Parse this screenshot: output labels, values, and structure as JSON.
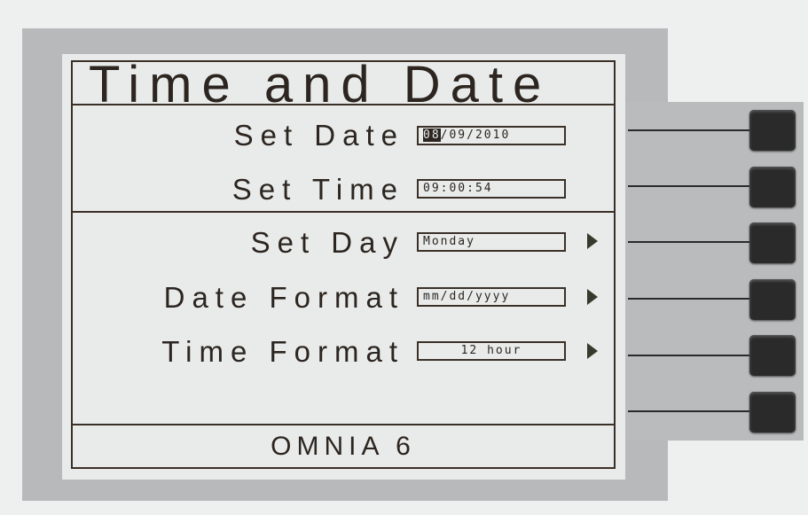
{
  "screen": {
    "title": "Time and Date",
    "footer": "OMNIA 6"
  },
  "rows": [
    {
      "label": "Set Date",
      "value_highlight": "08",
      "value_rest": "/09/2010",
      "has_arrow": false
    },
    {
      "label": "Set Time",
      "value": "09:00:54",
      "has_arrow": false
    },
    {
      "label": "Set Day",
      "value": "Monday",
      "has_arrow": true
    },
    {
      "label": "Date Format",
      "value": "mm/dd/yyyy",
      "has_arrow": true
    },
    {
      "label": "Time Format",
      "value": "12 hour",
      "has_arrow": true
    }
  ],
  "softkeys": {
    "count": 6
  }
}
